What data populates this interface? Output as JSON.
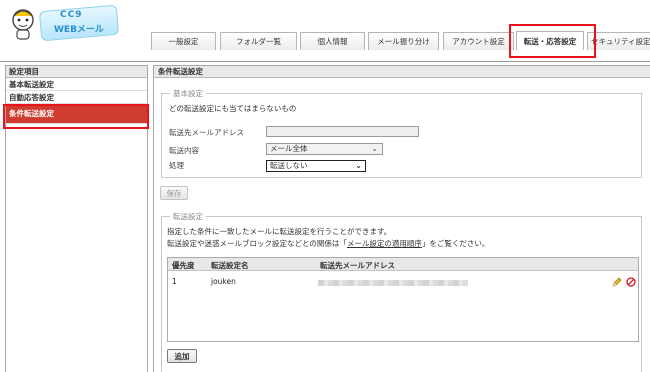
{
  "logo": {
    "line1": "CC9",
    "line2": "WEBメール"
  },
  "tabs": [
    {
      "label": "一般設定"
    },
    {
      "label": "フォルダ一覧"
    },
    {
      "label": "個人情報"
    },
    {
      "label": "メール振り分け"
    },
    {
      "label": "アカウント設定"
    },
    {
      "label": "転送・応答設定"
    },
    {
      "label": "セキュリティ設定"
    }
  ],
  "sidebar": {
    "header": "設定項目",
    "items": [
      {
        "label": "基本転送設定"
      },
      {
        "label": "自動応答設定"
      },
      {
        "label": "条件転送設定"
      }
    ]
  },
  "main": {
    "title": "条件転送設定",
    "basic": {
      "legend": "基本設定",
      "description": "どの転送設定にも当てはまらないもの",
      "dest_label": "転送先メールアドレス",
      "dest_value": "",
      "content_label": "転送内容",
      "content_value": "メール全体",
      "process_label": "処理",
      "process_value": "転送しない",
      "save_button": "保存"
    },
    "forward": {
      "legend": "転送設定",
      "line1": "指定した条件に一致したメールに転送設定を行うことができます。",
      "line2_pre": "転送設定や迷惑メールブロック設定などとの関係は「",
      "line2_link": "メール設定の適用順序",
      "line2_post": "」をご覧ください。",
      "table": {
        "headers": [
          "優先度",
          "転送設定名",
          "転送先メールアドレス"
        ],
        "rows": [
          {
            "priority": "1",
            "name": "jouken",
            "address": ""
          }
        ]
      },
      "add_button": "追加"
    }
  },
  "colors": {
    "highlight": "#e8141c",
    "active_sidebar": "#cf3b2f"
  }
}
